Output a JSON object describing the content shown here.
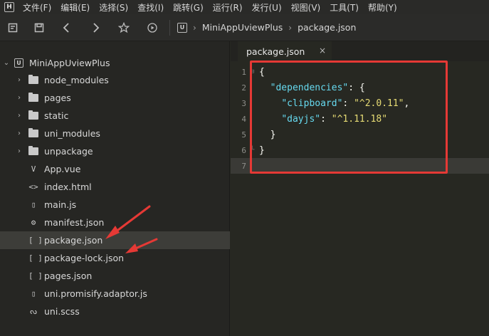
{
  "menubar": {
    "logo": "H",
    "items": [
      "文件(F)",
      "编辑(E)",
      "选择(S)",
      "查找(I)",
      "跳转(G)",
      "运行(R)",
      "发行(U)",
      "视图(V)",
      "工具(T)",
      "帮助(Y)"
    ]
  },
  "toolbar": {
    "breadcrumb_logo": "U",
    "breadcrumb_project": "MiniAppUviewPlus",
    "breadcrumb_file": "package.json"
  },
  "sidebar": {
    "items": [
      {
        "label": "MiniAppUviewPlus",
        "kind": "project",
        "expanded": true
      },
      {
        "label": "node_modules",
        "kind": "folder"
      },
      {
        "label": "pages",
        "kind": "folder"
      },
      {
        "label": "static",
        "kind": "folder"
      },
      {
        "label": "uni_modules",
        "kind": "folder"
      },
      {
        "label": "unpackage",
        "kind": "folder"
      },
      {
        "label": "App.vue",
        "kind": "file",
        "icon": "V"
      },
      {
        "label": "index.html",
        "kind": "file",
        "icon": "<>"
      },
      {
        "label": "main.js",
        "kind": "file",
        "icon": "js"
      },
      {
        "label": "manifest.json",
        "kind": "file",
        "icon": "gear"
      },
      {
        "label": "package.json",
        "kind": "file",
        "icon": "[ ]",
        "selected": true
      },
      {
        "label": "package-lock.json",
        "kind": "file",
        "icon": "[ ]"
      },
      {
        "label": "pages.json",
        "kind": "file",
        "icon": "[ ]"
      },
      {
        "label": "uni.promisify.adaptor.js",
        "kind": "file",
        "icon": "js"
      },
      {
        "label": "uni.scss",
        "kind": "file",
        "icon": "scss"
      }
    ]
  },
  "editor": {
    "tab_label": "package.json",
    "tab_close": "×",
    "line_numbers": [
      "1",
      "2",
      "3",
      "4",
      "5",
      "6",
      "7"
    ],
    "current_line": 7,
    "code": {
      "open_brace": "{",
      "dependencies_key": "\"dependencies\"",
      "clipboard_key": "\"clipboard\"",
      "clipboard_value": "\"^2.0.11\"",
      "dayjs_key": "\"dayjs\"",
      "dayjs_value": "\"^1.11.18\"",
      "inner_close": "}",
      "outer_close": "}"
    }
  },
  "colors": {
    "annotation_red": "#e53935",
    "json_key": "#66d9ef",
    "json_string": "#e6db74",
    "background": "#272822"
  }
}
